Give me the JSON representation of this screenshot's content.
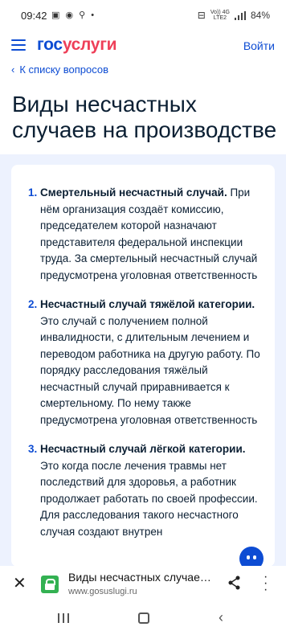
{
  "status_bar": {
    "time": "09:42",
    "notification_icons": [
      "image-icon",
      "message-icon",
      "search-bubble-icon",
      "dot"
    ],
    "network_top": "Vo)) 4G",
    "network_bottom": "LTE2",
    "battery": "84%"
  },
  "header": {
    "logo_part1": "гос",
    "logo_part2": "услуги",
    "login_label": "Войти",
    "brand_blue": "#0d4cd3",
    "brand_red": "#ee3f58"
  },
  "back_link": {
    "label": "К списку вопросов"
  },
  "page": {
    "title": "Виды несчастных случаев на производстве"
  },
  "items": [
    {
      "number": "1.",
      "heading": "Смертельный несчастный случай.",
      "text": " При нём организация создаёт комиссию, председателем которой назначают представителя федеральной инспекции труда. За смертельный несчастный случай предусмотрена уголовная ответственность"
    },
    {
      "number": "2.",
      "heading": "Несчастный случай тяжёлой категории.",
      "text": " Это случай с получением полной инвалидности, с длительным лечением и переводом работника на другую работу. По порядку расследования тяжёлый несчастный случай приравнивается к смертельному. По нему также предусмотрена уголовная ответственность"
    },
    {
      "number": "3.",
      "heading": "Несчастный случай лёгкой категории.",
      "text": " Это когда после лечения травмы нет последствий для здоровья, а работник продолжает работать по своей профессии. Для расследования такого несчастного случая создают внутрен"
    }
  ],
  "browser": {
    "tab_title": "Виды несчастных случаев на производстве",
    "url": "www.gosuslugi.ru"
  }
}
